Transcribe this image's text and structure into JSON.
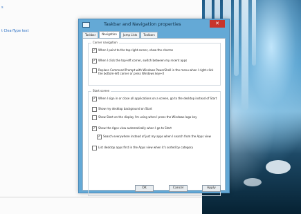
{
  "background_window": {
    "line1": "s",
    "line2": "t ClearType text"
  },
  "dialog": {
    "title": "Taskbar and Navigation properties",
    "close_glyph": "✕",
    "tabs": [
      "Taskbar",
      "Navigation",
      "Jump Lists",
      "Toolbars"
    ],
    "active_tab": "Navigation",
    "corner_navigation": {
      "heading": "Corner navigation",
      "options": [
        {
          "label": "When I point to the top-right corner, show the charms",
          "checked": true
        },
        {
          "label": "When I click the top-left corner, switch between my recent apps",
          "checked": true
        },
        {
          "label": "Replace Command Prompt with Windows PowerShell in the menu when I right-click the bottom-left corner or press Windows key+X",
          "checked": false
        }
      ]
    },
    "start_screen": {
      "heading": "Start screen",
      "options": [
        {
          "label": "When I sign in or close all applications on a screen, go to the desktop instead of Start",
          "checked": true
        },
        {
          "label": "Show my desktop background on Start",
          "checked": false
        },
        {
          "label": "Show Start on the display I'm using when I press the Windows logo key",
          "checked": false
        },
        {
          "label": "Show the Apps view automatically when I go to Start",
          "checked": true
        },
        {
          "label": "Search everywhere instead of just my apps when I search from the Apps view",
          "checked": true
        },
        {
          "label": "List desktop apps first in the Apps view when it's sorted by category",
          "checked": false
        }
      ]
    },
    "buttons": {
      "ok": "OK",
      "cancel": "Cancel",
      "apply": "Apply"
    }
  },
  "icons": {
    "title": "taskbar-icon",
    "check": "checkmark-icon"
  },
  "colors": {
    "titlebar": "#64a9d6",
    "close_button": "#c9352b",
    "link_text": "#2a6fc4"
  }
}
